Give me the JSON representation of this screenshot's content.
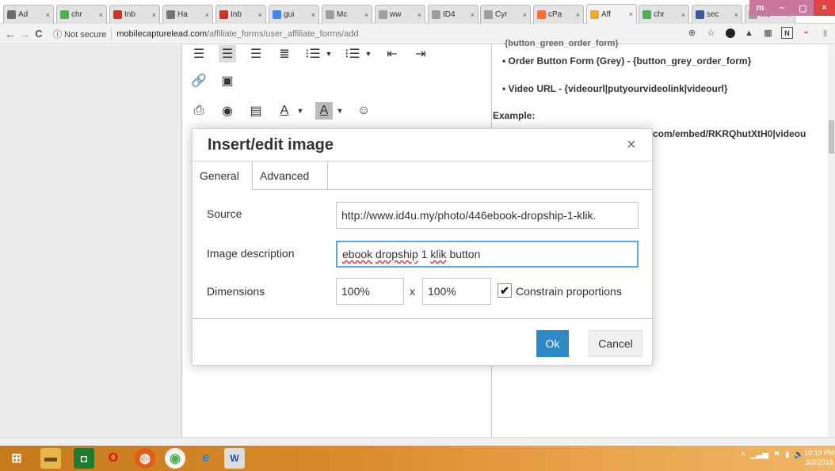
{
  "browser": {
    "tabs": [
      {
        "label": "Ad",
        "icon": "doc-icon",
        "color": "#6c6c6c"
      },
      {
        "label": "chr",
        "icon": "chrome-icon",
        "color": "#4caf50"
      },
      {
        "label": "Inb",
        "icon": "gmail-icon",
        "color": "#d93025"
      },
      {
        "label": "Ha",
        "icon": "image-icon",
        "color": "#777777"
      },
      {
        "label": "Inb",
        "icon": "gmail-icon",
        "color": "#d93025"
      },
      {
        "label": "gui",
        "icon": "google-icon",
        "color": "#4285f4"
      },
      {
        "label": "Mc",
        "icon": "page-icon",
        "color": "#9e9e9e"
      },
      {
        "label": "ww",
        "icon": "page-icon",
        "color": "#9e9e9e"
      },
      {
        "label": "ID4",
        "icon": "page-icon",
        "color": "#9e9e9e"
      },
      {
        "label": "Cyr",
        "icon": "page-icon",
        "color": "#9e9e9e"
      },
      {
        "label": "cPa",
        "icon": "cpanel-icon",
        "color": "#ff6c2c"
      },
      {
        "label": "Aff",
        "icon": "site-icon",
        "color": "#f5a623"
      },
      {
        "label": "chr",
        "icon": "chrome-icon",
        "color": "#4caf50"
      },
      {
        "label": "sec",
        "icon": "facebook-icon",
        "color": "#3b5998"
      },
      {
        "label": "Mc",
        "icon": "page-icon",
        "color": "#9e9e9e"
      }
    ],
    "close_glyph": "×",
    "window_controls": {
      "profile": "m",
      "minimize": "–",
      "maximize": "▢",
      "close": "×"
    },
    "back": "←",
    "forward": "→",
    "reload": "C",
    "secure_label": "ⓘ Not secure",
    "url_host": "mobilecapturelead.com",
    "url_path": "/affiliate_forms/user_affiliate_forms/add"
  },
  "page": {
    "right_lines": {
      "cut": "{button_green_order_form}",
      "grey": "• Order Button Form (Grey) - {button_grey_order_form}",
      "video": "• Video URL - {videourl|putyourvideolink|videourl}",
      "example": "Example:",
      "embed": "com/embed/RKRQhutXtH0|videou"
    }
  },
  "dialog": {
    "title": "Insert/edit image",
    "close": "×",
    "tabs": [
      "General",
      "Advanced"
    ],
    "source_label": "Source",
    "source_value": "http://www.id4u.my/photo/446ebook-dropship-1-klik.",
    "description_label": "Image description",
    "description_words": [
      "ebook",
      " ",
      "dropship",
      " 1 ",
      "klik",
      " button"
    ],
    "dimensions_label": "Dimensions",
    "width_value": "100%",
    "x_sep": "x",
    "height_value": "100%",
    "constrain_label": "Constrain proportions",
    "constrain_checked": "✔",
    "ok_label": "Ok",
    "cancel_label": "Cancel"
  },
  "taskbar": {
    "time": "10:19 PM",
    "date": "3/2/2018"
  },
  "colors": {
    "accent": "#2d8ac7",
    "focus": "#59a5e5",
    "close_red": "#e04343"
  }
}
